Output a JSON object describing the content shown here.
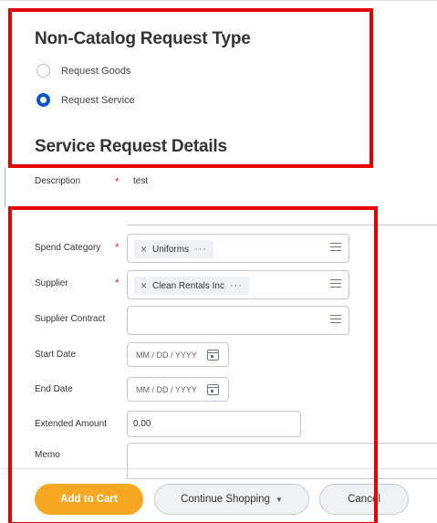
{
  "request_type": {
    "title": "Non-Catalog Request Type",
    "options": [
      {
        "label": "Request Goods",
        "selected": false
      },
      {
        "label": "Request Service",
        "selected": true
      }
    ]
  },
  "details": {
    "title": "Service Request Details",
    "description": {
      "label": "Description",
      "required": "*",
      "value": "test"
    },
    "spend_category": {
      "label": "Spend Category",
      "required": "*",
      "value": "Uniforms",
      "remove": "×",
      "more": "···"
    },
    "supplier": {
      "label": "Supplier",
      "required": "*",
      "value": "Clean Rentals Inc",
      "remove": "×",
      "more": "···"
    },
    "supplier_contract": {
      "label": "Supplier Contract",
      "value": ""
    },
    "start_date": {
      "label": "Start Date",
      "placeholder": "MM / DD / YYYY"
    },
    "end_date": {
      "label": "End Date",
      "placeholder": "MM / DD / YYYY"
    },
    "extended_amount": {
      "label": "Extended Amount",
      "value": "0.00"
    },
    "memo": {
      "label": "Memo",
      "value": ""
    }
  },
  "actions": {
    "add_to_cart": "Add to Cart",
    "continue_shopping": "Continue Shopping",
    "continue_caret": "▼",
    "cancel": "Cancel"
  },
  "colors": {
    "primary_button": "#f7a823",
    "radio_selected": "#0e55c8",
    "required_asterisk": "#d0312d",
    "highlight_box": "#e60000"
  },
  "icons": [
    "radio-button",
    "prompt-list-icon",
    "calendar-icon",
    "remove-x-icon",
    "more-dots-icon",
    "caret-down-icon"
  ]
}
